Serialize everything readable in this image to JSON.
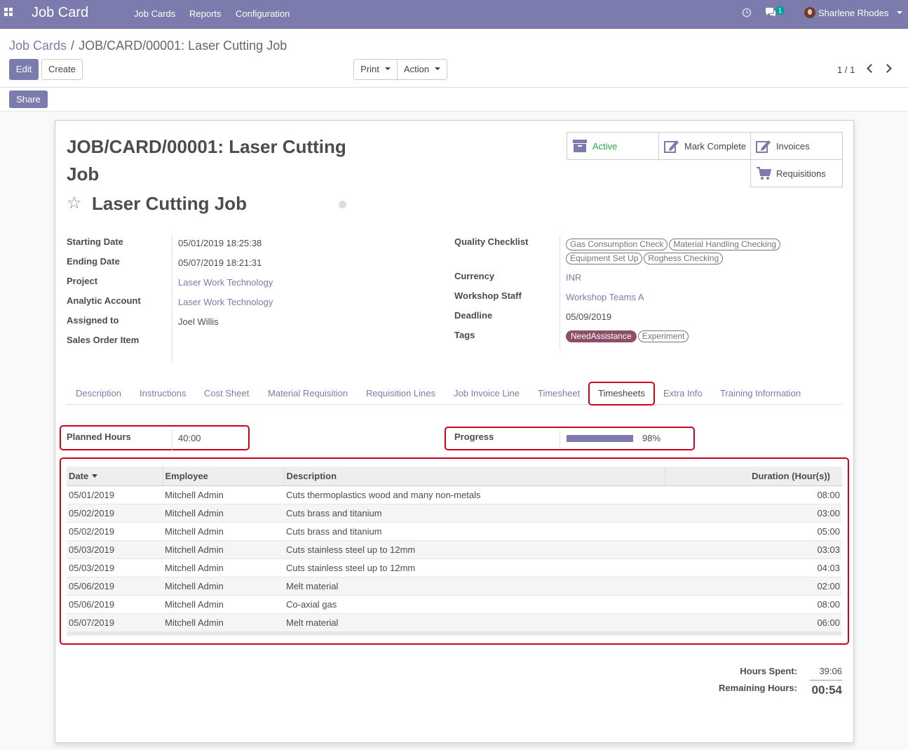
{
  "navbar": {
    "app_title": "Job Card",
    "menu": [
      "Job Cards",
      "Reports",
      "Configuration"
    ],
    "messages_count": "1",
    "user_name": "Sharlene Rhodes"
  },
  "breadcrumb": {
    "parent": "Job Cards",
    "separator": "/",
    "current": "JOB/CARD/00001: Laser Cutting Job"
  },
  "controls": {
    "edit_label": "Edit",
    "create_label": "Create",
    "print_label": "Print",
    "action_label": "Action",
    "pager": "1 / 1",
    "share_label": "Share"
  },
  "record": {
    "title": "JOB/CARD/00001: Laser Cutting Job",
    "name": "Laser Cutting Job"
  },
  "smart_buttons": {
    "active": "Active",
    "mark_complete": "Mark Complete",
    "invoices": "Invoices",
    "requisitions": "Requisitions"
  },
  "colors": {
    "brand": "#7c7bad",
    "active_green": "#28a745",
    "highlight_red": "#d0021b",
    "tag_need_assistance": "#8e4e6a"
  },
  "fields_left": [
    {
      "label": "Starting Date",
      "value": "05/01/2019 18:25:38"
    },
    {
      "label": "Ending Date",
      "value": "05/07/2019 18:21:31"
    },
    {
      "label": "Project",
      "value": "Laser Work Technology"
    },
    {
      "label": "Analytic Account",
      "value": "Laser Work Technology"
    },
    {
      "label": "Assigned to",
      "value": "Joel Willis"
    },
    {
      "label": "Sales Order Item",
      "value": ""
    }
  ],
  "fields_right": {
    "quality_checklist_label": "Quality Checklist",
    "quality_checklist": [
      "Gas Consumption Check",
      "Material Handling Checking",
      "Equipment Set Up",
      "Roghess Checking"
    ],
    "currency_label": "Currency",
    "currency": "INR",
    "workshop_staff_label": "Workshop Staff",
    "workshop_staff": "Workshop Teams A",
    "deadline_label": "Deadline",
    "deadline": "05/09/2019",
    "tags_label": "Tags",
    "tags": [
      "NeedAssistance",
      "Experiment"
    ]
  },
  "tabs": [
    "Description",
    "Instructions",
    "Cost Sheet",
    "Material Requisition",
    "Requisition Lines",
    "Job Invoice Line",
    "Timesheet",
    "Timesheets",
    "Extra Info",
    "Training Information"
  ],
  "active_tab": "Timesheets",
  "timesheets": {
    "planned_hours_label": "Planned Hours",
    "planned_hours": "40:00",
    "progress_label": "Progress",
    "progress_text": "98%",
    "progress_value": 98,
    "columns": [
      "Date",
      "Employee",
      "Description",
      "Duration (Hour(s))"
    ],
    "rows": [
      {
        "date": "05/01/2019",
        "employee": "Mitchell Admin",
        "description": "Cuts thermoplastics wood and many non-metals",
        "duration": "08:00"
      },
      {
        "date": "05/02/2019",
        "employee": "Mitchell Admin",
        "description": "Cuts brass and titanium",
        "duration": "03:00"
      },
      {
        "date": "05/02/2019",
        "employee": "Mitchell Admin",
        "description": "Cuts brass and titanium",
        "duration": "05:00"
      },
      {
        "date": "05/03/2019",
        "employee": "Mitchell Admin",
        "description": "Cuts stainless steel up to 12mm",
        "duration": "03:03"
      },
      {
        "date": "05/03/2019",
        "employee": "Mitchell Admin",
        "description": "Cuts stainless steel up to 12mm",
        "duration": "04:03"
      },
      {
        "date": "05/06/2019",
        "employee": "Mitchell Admin",
        "description": "Melt material",
        "duration": "02:00"
      },
      {
        "date": "05/06/2019",
        "employee": "Mitchell Admin",
        "description": "Co-axial gas",
        "duration": "08:00"
      },
      {
        "date": "05/07/2019",
        "employee": "Mitchell Admin",
        "description": "Melt material",
        "duration": "06:00"
      }
    ],
    "hours_spent_label": "Hours Spent:",
    "hours_spent": "39:06",
    "remaining_hours_label": "Remaining Hours:",
    "remaining_hours": "00:54"
  }
}
